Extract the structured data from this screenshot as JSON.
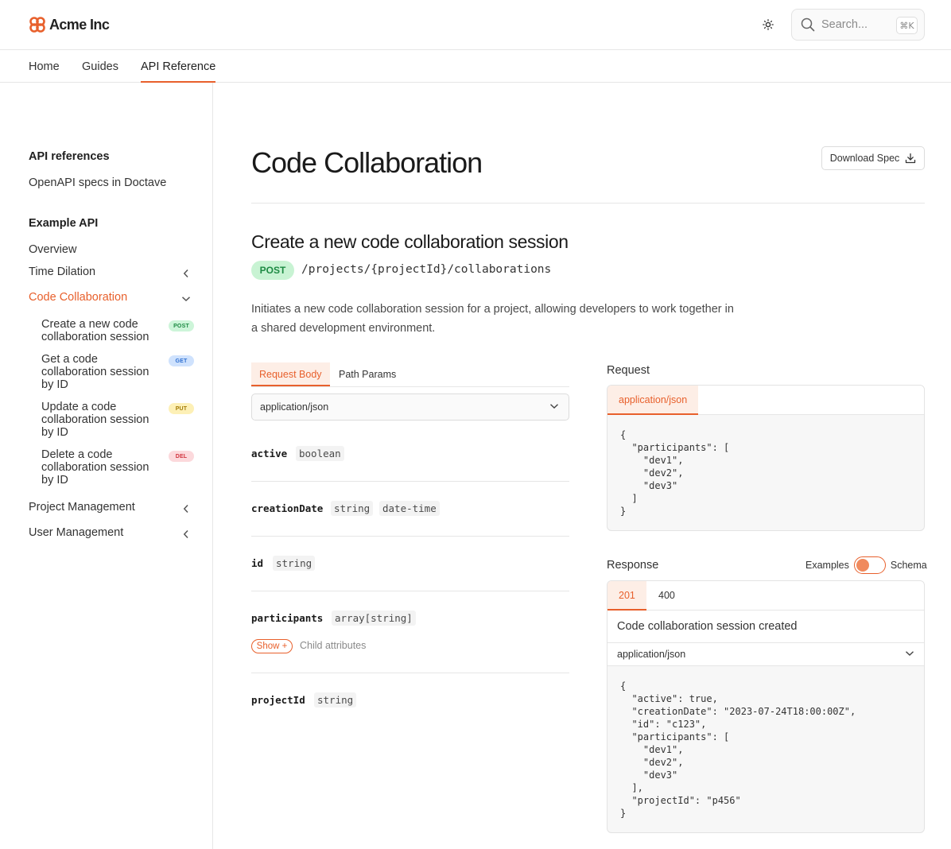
{
  "brand": {
    "name": "Acme Inc",
    "accent": "#e8602c"
  },
  "search": {
    "placeholder": "Search...",
    "shortcut": "⌘K"
  },
  "nav": {
    "tabs": [
      "Home",
      "Guides",
      "API Reference"
    ],
    "active": "API Reference"
  },
  "sidebar": {
    "section1_heading": "API references",
    "section1_item": "OpenAPI specs in Doctave",
    "section2_heading": "Example API",
    "items": {
      "overview": "Overview",
      "time_dilation": "Time Dilation",
      "code_collaboration": "Code Collaboration",
      "project_management": "Project Management",
      "user_management": "User Management"
    },
    "sub_items": [
      {
        "label": "Create a new code collaboration session",
        "badge": "POST"
      },
      {
        "label": "Get a code collaboration session by ID",
        "badge": "GET"
      },
      {
        "label": "Update a code collaboration session by ID",
        "badge": "PUT"
      },
      {
        "label": "Delete a code collaboration session by ID",
        "badge": "DEL"
      }
    ]
  },
  "page": {
    "title": "Code Collaboration",
    "download_label": "Download Spec",
    "operation_title": "Create a new code collaboration session",
    "method": "POST",
    "path": "/projects/{projectId}/collaborations",
    "description": "Initiates a new code collaboration session for a project, allowing developers to work together in a shared development environment."
  },
  "request_tabs": [
    "Request Body",
    "Path Params"
  ],
  "content_type": "application/json",
  "params": [
    {
      "name": "active",
      "types": [
        "boolean"
      ]
    },
    {
      "name": "creationDate",
      "types": [
        "string",
        "date-time"
      ]
    },
    {
      "name": "id",
      "types": [
        "string"
      ]
    },
    {
      "name": "participants",
      "types": [
        "array[string]"
      ],
      "show_label": "Show +",
      "child_label": "Child attributes"
    },
    {
      "name": "projectId",
      "types": [
        "string"
      ]
    }
  ],
  "request_panel": {
    "label": "Request",
    "tab": "application/json",
    "code": "{\n  \"participants\": [\n    \"dev1\",\n    \"dev2\",\n    \"dev3\"\n  ]\n}"
  },
  "response_panel": {
    "label": "Response",
    "toggle_left": "Examples",
    "toggle_right": "Schema",
    "tabs": [
      "201",
      "400"
    ],
    "description": "Code collaboration session created",
    "content_type": "application/json",
    "code": "{\n  \"active\": true,\n  \"creationDate\": \"2023-07-24T18:00:00Z\",\n  \"id\": \"c123\",\n  \"participants\": [\n    \"dev1\",\n    \"dev2\",\n    \"dev3\"\n  ],\n  \"projectId\": \"p456\"\n}"
  }
}
